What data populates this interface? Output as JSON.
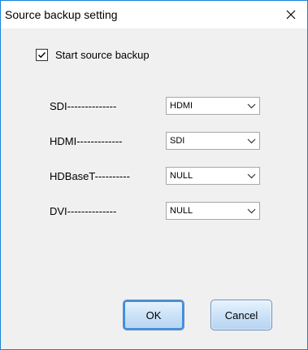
{
  "window": {
    "title": "Source backup setting"
  },
  "backup": {
    "checkbox_label": "Start source backup",
    "checked": true,
    "rows": [
      {
        "label": "SDI--------------",
        "selected": "HDMI"
      },
      {
        "label": "HDMI-------------",
        "selected": "SDI"
      },
      {
        "label": "HDBaseT----------",
        "selected": "NULL"
      },
      {
        "label": "DVI--------------",
        "selected": "NULL"
      }
    ]
  },
  "buttons": {
    "ok": "OK",
    "cancel": "Cancel"
  },
  "icons": {
    "close": "close-icon",
    "check": "checkmark-icon",
    "dropdown": "chevron-down-icon"
  },
  "colors": {
    "accent_border": "#1883d7",
    "button_focus": "#3a8fe0"
  }
}
